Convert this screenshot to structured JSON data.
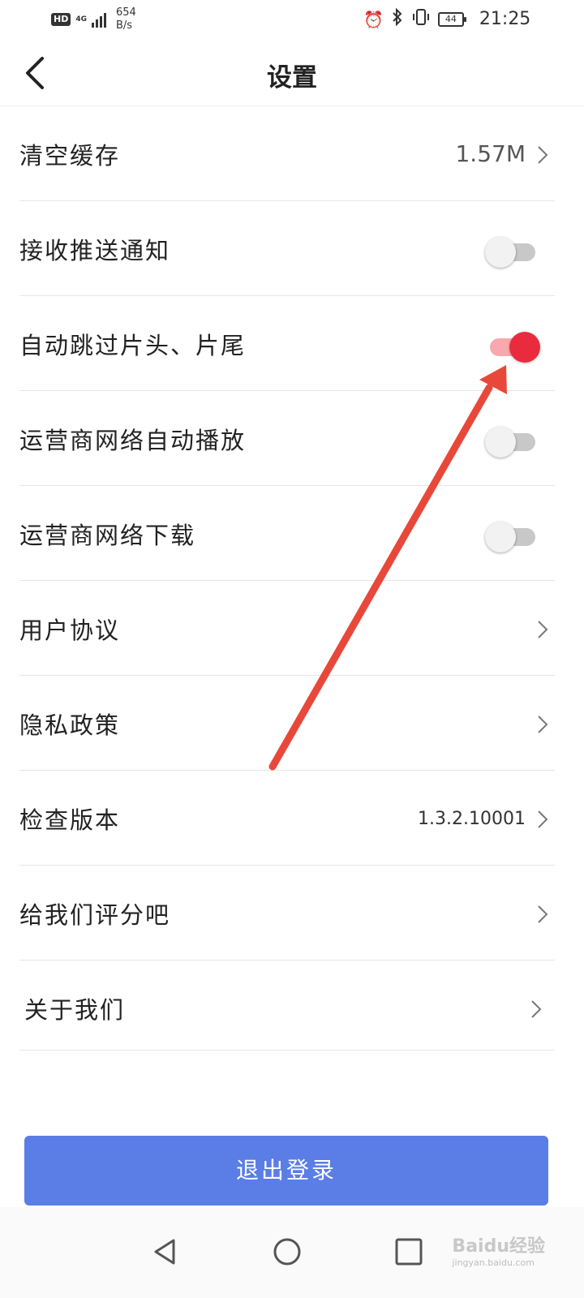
{
  "status_bar": {
    "hd": "HD",
    "net_type": "4G",
    "speed_value": "654",
    "speed_unit": "B/s",
    "battery": "44",
    "time": "21:25"
  },
  "header": {
    "title": "设置"
  },
  "settings": [
    {
      "label": "清空缓存",
      "value": "1.57M",
      "control": "chevron"
    },
    {
      "label": "接收推送通知",
      "control": "toggle",
      "on": false
    },
    {
      "label": "自动跳过片头、片尾",
      "control": "toggle",
      "on": true
    },
    {
      "label": "运营商网络自动播放",
      "control": "toggle",
      "on": false
    },
    {
      "label": "运营商网络下载",
      "control": "toggle",
      "on": false
    },
    {
      "label": "用户协议",
      "control": "chevron"
    },
    {
      "label": "隐私政策",
      "control": "chevron"
    },
    {
      "label": "检查版本",
      "value": "1.3.2.10001",
      "control": "chevron"
    },
    {
      "label": "给我们评分吧",
      "control": "chevron"
    },
    {
      "label": "关于我们",
      "control": "chevron"
    }
  ],
  "logout_label": "退出登录",
  "watermark": {
    "brand": "Baidu经验",
    "url": "jingyan.baidu.com"
  },
  "colors": {
    "accent_button": "#5a7de6",
    "toggle_on": "#ea2b3e",
    "annotation_arrow": "#e8483a"
  }
}
